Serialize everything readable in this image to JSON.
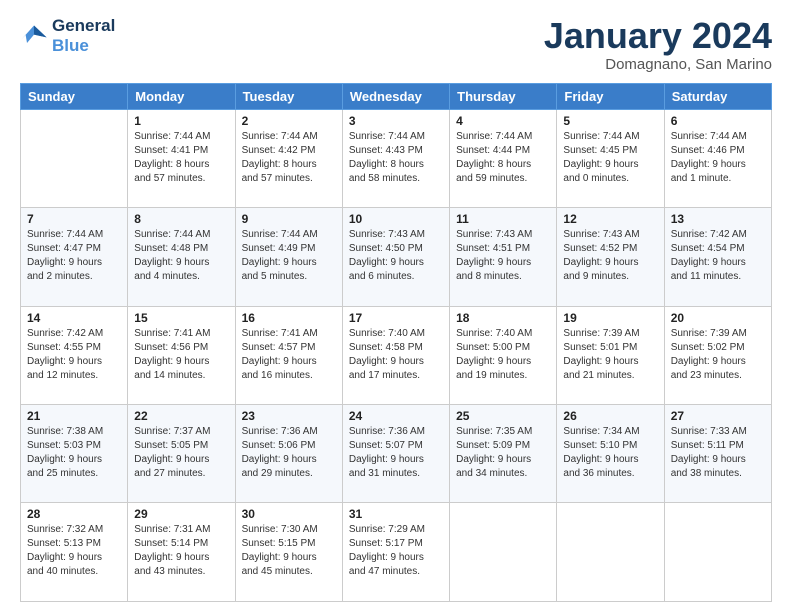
{
  "logo": {
    "line1": "General",
    "line2": "Blue"
  },
  "title": "January 2024",
  "subtitle": "Domagnano, San Marino",
  "weekdays": [
    "Sunday",
    "Monday",
    "Tuesday",
    "Wednesday",
    "Thursday",
    "Friday",
    "Saturday"
  ],
  "weeks": [
    [
      {
        "day": "",
        "sunrise": "",
        "sunset": "",
        "daylight": ""
      },
      {
        "day": "1",
        "sunrise": "Sunrise: 7:44 AM",
        "sunset": "Sunset: 4:41 PM",
        "daylight": "Daylight: 8 hours and 57 minutes."
      },
      {
        "day": "2",
        "sunrise": "Sunrise: 7:44 AM",
        "sunset": "Sunset: 4:42 PM",
        "daylight": "Daylight: 8 hours and 57 minutes."
      },
      {
        "day": "3",
        "sunrise": "Sunrise: 7:44 AM",
        "sunset": "Sunset: 4:43 PM",
        "daylight": "Daylight: 8 hours and 58 minutes."
      },
      {
        "day": "4",
        "sunrise": "Sunrise: 7:44 AM",
        "sunset": "Sunset: 4:44 PM",
        "daylight": "Daylight: 8 hours and 59 minutes."
      },
      {
        "day": "5",
        "sunrise": "Sunrise: 7:44 AM",
        "sunset": "Sunset: 4:45 PM",
        "daylight": "Daylight: 9 hours and 0 minutes."
      },
      {
        "day": "6",
        "sunrise": "Sunrise: 7:44 AM",
        "sunset": "Sunset: 4:46 PM",
        "daylight": "Daylight: 9 hours and 1 minute."
      }
    ],
    [
      {
        "day": "7",
        "sunrise": "Sunrise: 7:44 AM",
        "sunset": "Sunset: 4:47 PM",
        "daylight": "Daylight: 9 hours and 2 minutes."
      },
      {
        "day": "8",
        "sunrise": "Sunrise: 7:44 AM",
        "sunset": "Sunset: 4:48 PM",
        "daylight": "Daylight: 9 hours and 4 minutes."
      },
      {
        "day": "9",
        "sunrise": "Sunrise: 7:44 AM",
        "sunset": "Sunset: 4:49 PM",
        "daylight": "Daylight: 9 hours and 5 minutes."
      },
      {
        "day": "10",
        "sunrise": "Sunrise: 7:43 AM",
        "sunset": "Sunset: 4:50 PM",
        "daylight": "Daylight: 9 hours and 6 minutes."
      },
      {
        "day": "11",
        "sunrise": "Sunrise: 7:43 AM",
        "sunset": "Sunset: 4:51 PM",
        "daylight": "Daylight: 9 hours and 8 minutes."
      },
      {
        "day": "12",
        "sunrise": "Sunrise: 7:43 AM",
        "sunset": "Sunset: 4:52 PM",
        "daylight": "Daylight: 9 hours and 9 minutes."
      },
      {
        "day": "13",
        "sunrise": "Sunrise: 7:42 AM",
        "sunset": "Sunset: 4:54 PM",
        "daylight": "Daylight: 9 hours and 11 minutes."
      }
    ],
    [
      {
        "day": "14",
        "sunrise": "Sunrise: 7:42 AM",
        "sunset": "Sunset: 4:55 PM",
        "daylight": "Daylight: 9 hours and 12 minutes."
      },
      {
        "day": "15",
        "sunrise": "Sunrise: 7:41 AM",
        "sunset": "Sunset: 4:56 PM",
        "daylight": "Daylight: 9 hours and 14 minutes."
      },
      {
        "day": "16",
        "sunrise": "Sunrise: 7:41 AM",
        "sunset": "Sunset: 4:57 PM",
        "daylight": "Daylight: 9 hours and 16 minutes."
      },
      {
        "day": "17",
        "sunrise": "Sunrise: 7:40 AM",
        "sunset": "Sunset: 4:58 PM",
        "daylight": "Daylight: 9 hours and 17 minutes."
      },
      {
        "day": "18",
        "sunrise": "Sunrise: 7:40 AM",
        "sunset": "Sunset: 5:00 PM",
        "daylight": "Daylight: 9 hours and 19 minutes."
      },
      {
        "day": "19",
        "sunrise": "Sunrise: 7:39 AM",
        "sunset": "Sunset: 5:01 PM",
        "daylight": "Daylight: 9 hours and 21 minutes."
      },
      {
        "day": "20",
        "sunrise": "Sunrise: 7:39 AM",
        "sunset": "Sunset: 5:02 PM",
        "daylight": "Daylight: 9 hours and 23 minutes."
      }
    ],
    [
      {
        "day": "21",
        "sunrise": "Sunrise: 7:38 AM",
        "sunset": "Sunset: 5:03 PM",
        "daylight": "Daylight: 9 hours and 25 minutes."
      },
      {
        "day": "22",
        "sunrise": "Sunrise: 7:37 AM",
        "sunset": "Sunset: 5:05 PM",
        "daylight": "Daylight: 9 hours and 27 minutes."
      },
      {
        "day": "23",
        "sunrise": "Sunrise: 7:36 AM",
        "sunset": "Sunset: 5:06 PM",
        "daylight": "Daylight: 9 hours and 29 minutes."
      },
      {
        "day": "24",
        "sunrise": "Sunrise: 7:36 AM",
        "sunset": "Sunset: 5:07 PM",
        "daylight": "Daylight: 9 hours and 31 minutes."
      },
      {
        "day": "25",
        "sunrise": "Sunrise: 7:35 AM",
        "sunset": "Sunset: 5:09 PM",
        "daylight": "Daylight: 9 hours and 34 minutes."
      },
      {
        "day": "26",
        "sunrise": "Sunrise: 7:34 AM",
        "sunset": "Sunset: 5:10 PM",
        "daylight": "Daylight: 9 hours and 36 minutes."
      },
      {
        "day": "27",
        "sunrise": "Sunrise: 7:33 AM",
        "sunset": "Sunset: 5:11 PM",
        "daylight": "Daylight: 9 hours and 38 minutes."
      }
    ],
    [
      {
        "day": "28",
        "sunrise": "Sunrise: 7:32 AM",
        "sunset": "Sunset: 5:13 PM",
        "daylight": "Daylight: 9 hours and 40 minutes."
      },
      {
        "day": "29",
        "sunrise": "Sunrise: 7:31 AM",
        "sunset": "Sunset: 5:14 PM",
        "daylight": "Daylight: 9 hours and 43 minutes."
      },
      {
        "day": "30",
        "sunrise": "Sunrise: 7:30 AM",
        "sunset": "Sunset: 5:15 PM",
        "daylight": "Daylight: 9 hours and 45 minutes."
      },
      {
        "day": "31",
        "sunrise": "Sunrise: 7:29 AM",
        "sunset": "Sunset: 5:17 PM",
        "daylight": "Daylight: 9 hours and 47 minutes."
      },
      {
        "day": "",
        "sunrise": "",
        "sunset": "",
        "daylight": ""
      },
      {
        "day": "",
        "sunrise": "",
        "sunset": "",
        "daylight": ""
      },
      {
        "day": "",
        "sunrise": "",
        "sunset": "",
        "daylight": ""
      }
    ]
  ]
}
